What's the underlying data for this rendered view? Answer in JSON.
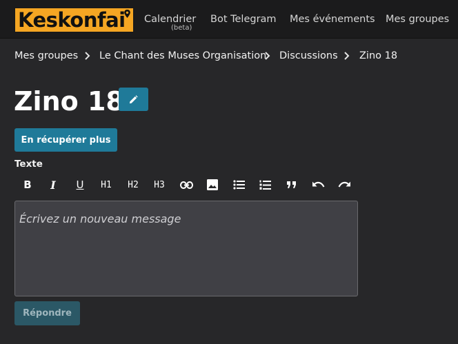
{
  "navbar": {
    "logo_text": "Keskonfai",
    "links": [
      {
        "label": "Calendrier",
        "badge": "(beta)"
      },
      {
        "label": "Bot Telegram"
      },
      {
        "label": "Mes événements"
      },
      {
        "label": "Mes groupes"
      }
    ]
  },
  "breadcrumb": [
    "Mes groupes",
    "Le Chant des Muses Organisation",
    "Discussions",
    "Zino 18"
  ],
  "page": {
    "title": "Zino 18",
    "more_button": "En récupérer plus"
  },
  "editor": {
    "label": "Texte",
    "placeholder": "Écrivez un nouveau message",
    "toolbar": [
      {
        "icon": "bold-icon",
        "glyph": "B"
      },
      {
        "icon": "italic-icon",
        "glyph": "I"
      },
      {
        "icon": "underline-icon",
        "glyph": "U"
      },
      {
        "icon": "heading1-icon",
        "glyph": "H1"
      },
      {
        "icon": "heading2-icon",
        "glyph": "H2"
      },
      {
        "icon": "heading3-icon",
        "glyph": "H3"
      },
      {
        "icon": "link-icon"
      },
      {
        "icon": "image-icon"
      },
      {
        "icon": "bullet-list-icon"
      },
      {
        "icon": "numbered-list-icon"
      },
      {
        "icon": "quote-icon"
      },
      {
        "icon": "undo-icon"
      },
      {
        "icon": "redo-icon"
      }
    ],
    "submit_label": "Répondre"
  },
  "colors": {
    "background": "#272729",
    "navbar": "#1b1b1c",
    "accent": "#1f7a99",
    "logo": "#f5a623",
    "editor_bg": "#404045"
  }
}
